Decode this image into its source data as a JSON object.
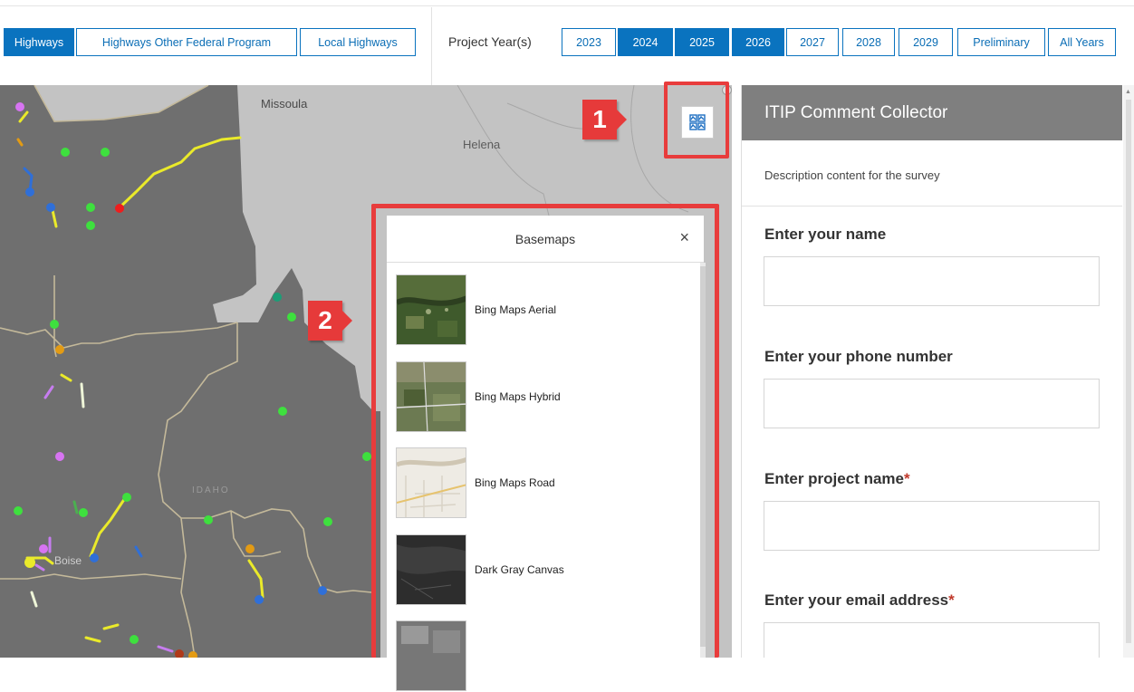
{
  "top_bar": {
    "program_buttons": [
      {
        "label": "Highways",
        "active": true
      },
      {
        "label": "Highways Other Federal Program",
        "active": false
      },
      {
        "label": "Local Highways",
        "active": false
      }
    ],
    "project_year_label": "Project Year(s)",
    "year_buttons": [
      {
        "label": "2023",
        "active": false
      },
      {
        "label": "2024",
        "active": true
      },
      {
        "label": "2025",
        "active": true
      },
      {
        "label": "2026",
        "active": true
      },
      {
        "label": "2027",
        "active": false
      },
      {
        "label": "2028",
        "active": false
      },
      {
        "label": "2029",
        "active": false
      },
      {
        "label": "Preliminary",
        "active": false
      },
      {
        "label": "All Years",
        "active": false
      }
    ]
  },
  "map": {
    "labels": {
      "missoula": "Missoula",
      "helena": "Helena",
      "idaho": "IDAHO",
      "boise": "Boise"
    },
    "basemap_widget_icon": "basemap-gallery-icon"
  },
  "callouts": {
    "one": "1",
    "two": "2"
  },
  "basemap_gallery": {
    "title": "Basemaps",
    "close_glyph": "×",
    "items": [
      {
        "label": "Bing Maps Aerial"
      },
      {
        "label": "Bing Maps Hybrid"
      },
      {
        "label": "Bing Maps Road"
      },
      {
        "label": "Dark Gray Canvas"
      },
      {
        "label": ""
      }
    ]
  },
  "survey_panel": {
    "title": "ITIP Comment Collector",
    "description": "Description content for the survey",
    "fields": [
      {
        "label": "Enter your name",
        "required": false,
        "value": ""
      },
      {
        "label": "Enter your phone number",
        "required": false,
        "value": ""
      },
      {
        "label": "Enter project name",
        "required": true,
        "value": ""
      },
      {
        "label": "Enter your email address",
        "required": true,
        "value": ""
      }
    ],
    "required_marker": "*"
  },
  "colors": {
    "button_blue": "#0a73bf",
    "callout_red": "#e63a3a",
    "panel_header": "#7f7f7f",
    "map_region": "#6e6e6e",
    "map_outside": "#c2c2c2"
  }
}
